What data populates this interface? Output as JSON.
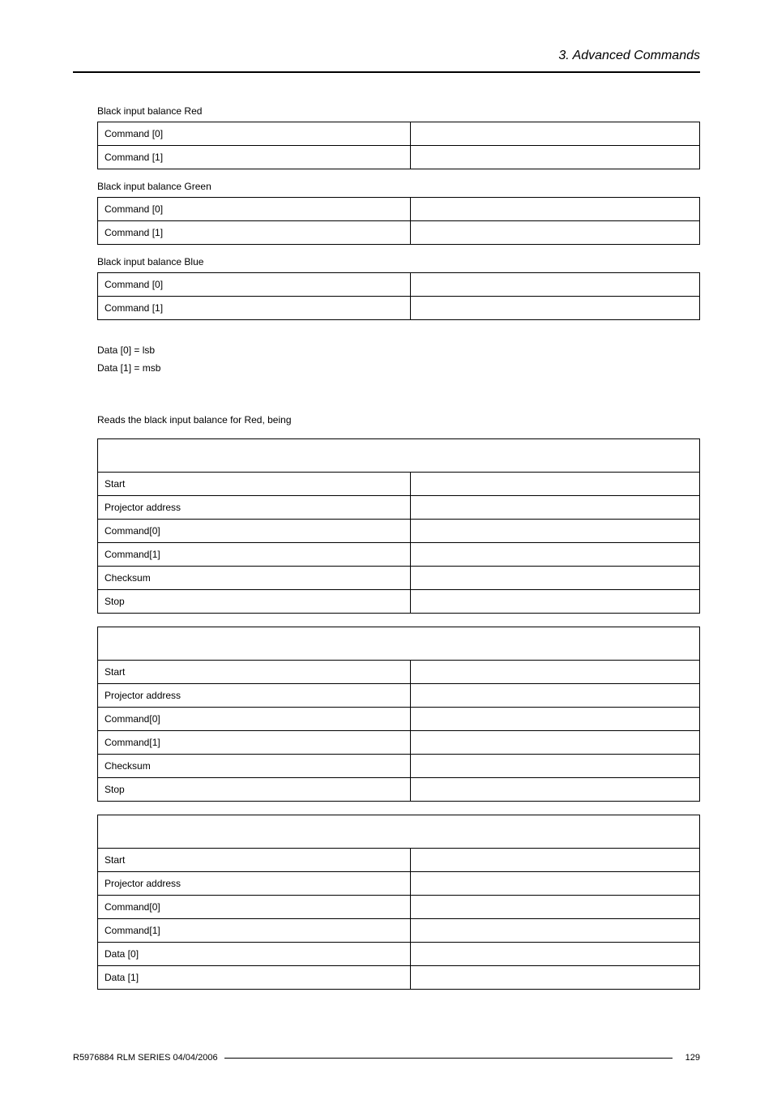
{
  "header": {
    "section_title": "3.  Advanced Commands"
  },
  "sections": {
    "red": {
      "label": "Black input balance Red",
      "rows": [
        "Command [0]",
        "Command [1]"
      ]
    },
    "green": {
      "label": "Black input balance Green",
      "rows": [
        "Command [0]",
        "Command [1]"
      ]
    },
    "blue": {
      "label": "Black input balance Blue",
      "rows": [
        "Command [0]",
        "Command [1]"
      ]
    }
  },
  "data_notes": {
    "lsb": "Data [0] = lsb",
    "msb": "Data [1] = msb"
  },
  "example_intro": "Reads the black input balance for Red, being",
  "tables": {
    "t1": {
      "rows": [
        "Start",
        "Projector address",
        "Command[0]",
        "Command[1]",
        "Checksum",
        "Stop"
      ]
    },
    "t2": {
      "rows": [
        "Start",
        "Projector address",
        "Command[0]",
        "Command[1]",
        "Checksum",
        "Stop"
      ]
    },
    "t3": {
      "rows": [
        "Start",
        "Projector address",
        "Command[0]",
        "Command[1]",
        "Data [0]",
        "Data [1]"
      ]
    }
  },
  "footer": {
    "doc_id": "R5976884  RLM SERIES  04/04/2006",
    "page": "129"
  }
}
